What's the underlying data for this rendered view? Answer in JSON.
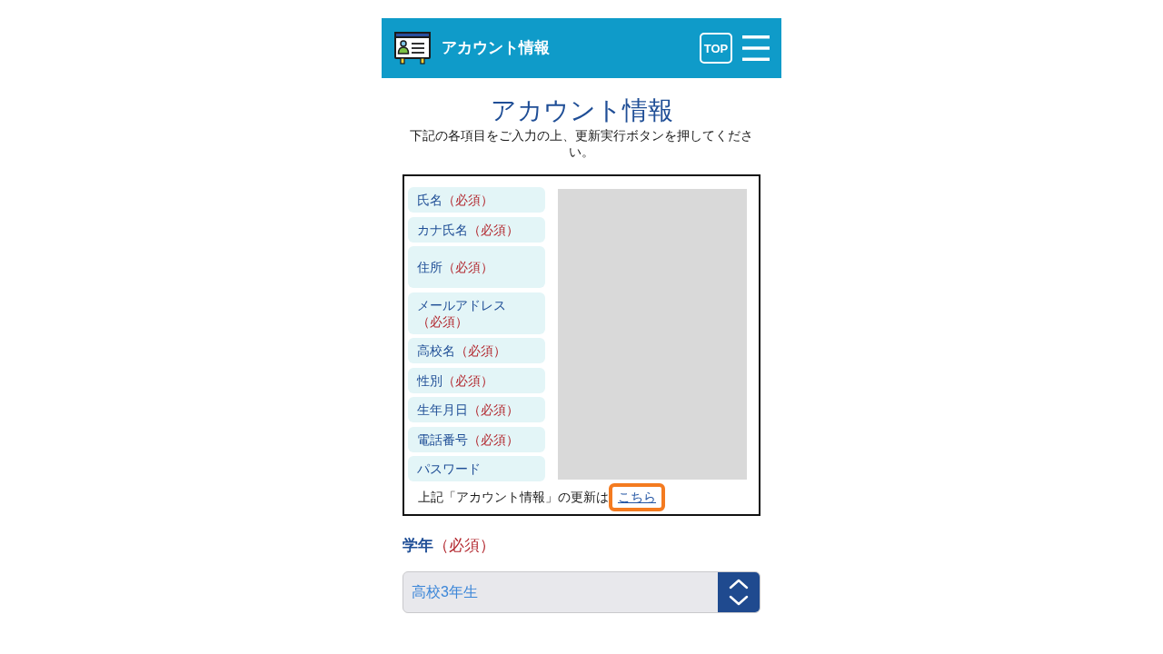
{
  "header": {
    "title": "アカウント情報",
    "top_button": "TOP"
  },
  "page": {
    "title": "アカウント情報",
    "instructions": "下記の各項目をご入力の上、更新実行ボタンを押してください。"
  },
  "account_fields": [
    {
      "label": "氏名",
      "required_mark": "（必須）"
    },
    {
      "label": "カナ氏名",
      "required_mark": "（必須）"
    },
    {
      "label": "住所",
      "required_mark": "（必須）"
    },
    {
      "label": "メールアドレス",
      "required_mark": "（必須）"
    },
    {
      "label": "高校名",
      "required_mark": "（必須）"
    },
    {
      "label": "性別",
      "required_mark": "（必須）"
    },
    {
      "label": "生年月日",
      "required_mark": "（必須）"
    },
    {
      "label": "電話番号",
      "required_mark": "（必須）"
    },
    {
      "label": "パスワード"
    }
  ],
  "update_note": {
    "text": "上記「アカウント情報」の更新は",
    "link": "こちら",
    "link_highlighted": true
  },
  "grade": {
    "label": "学年",
    "required_mark": "（必須）",
    "value": "高校3年生"
  }
}
